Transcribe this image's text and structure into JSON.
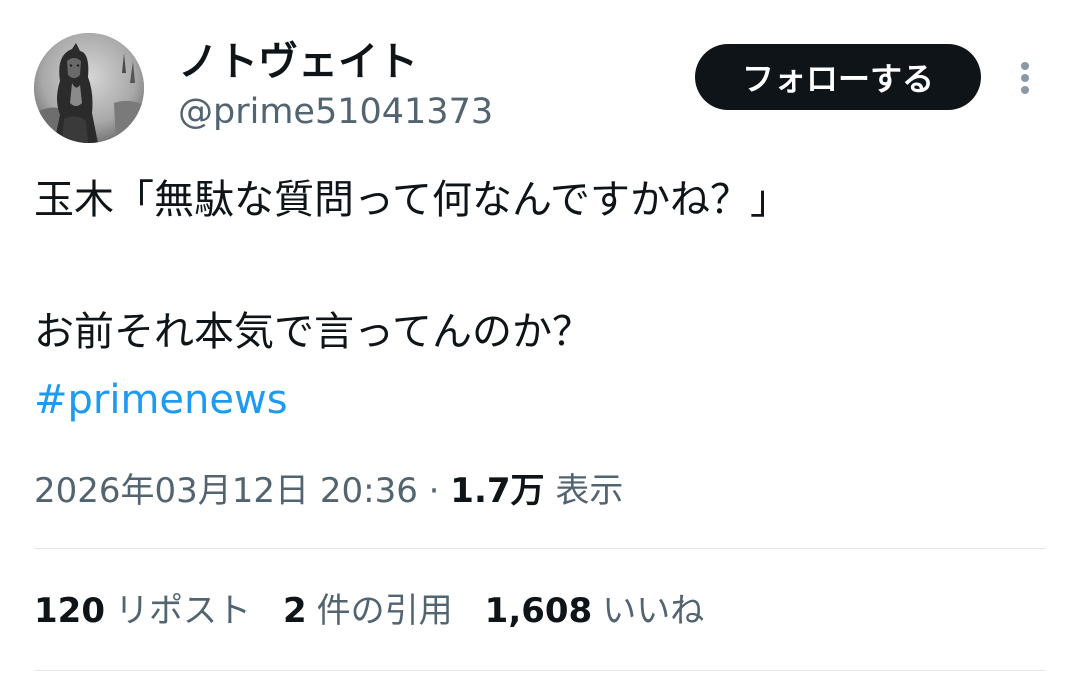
{
  "user": {
    "display_name": "ノトヴェイト",
    "handle": "@prime51041373",
    "avatar_icon": "profile-photo-grayscale-figure"
  },
  "follow_button": {
    "label": "フォローする",
    "bg_color": "#0f1419",
    "text_color": "#ffffff"
  },
  "more_icon": "more-vertical-icon",
  "tweet": {
    "line1": "玉木「無駄な質問って何なんですかね？」",
    "line2": "お前それ本気で言ってんのか？",
    "hashtag": "#primenews",
    "hashtag_color": "#1d9bf0"
  },
  "meta": {
    "timestamp": "2026年03月12日 20:36",
    "separator": "·",
    "views_count": "1.7万",
    "views_label": "表示"
  },
  "stats": {
    "reposts_count": "120",
    "reposts_label": "リポスト",
    "quotes_count": "2",
    "quotes_label": "件の引用",
    "likes_count": "1,608",
    "likes_label": "いいね"
  }
}
